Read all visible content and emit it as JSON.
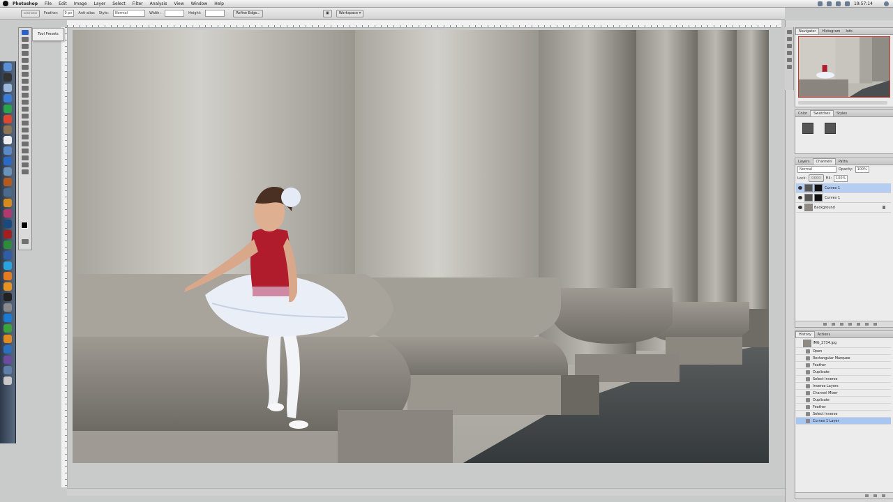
{
  "menubar": {
    "app_name": "Photoshop",
    "items": [
      "File",
      "Edit",
      "Image",
      "Layer",
      "Select",
      "Filter",
      "Analysis",
      "View",
      "Window",
      "Help"
    ],
    "clock": "19:57:14"
  },
  "optionsbar": {
    "feather_label": "Feather:",
    "feather_value": "0 px",
    "antialias_label": "Anti-alias",
    "style_label": "Style:",
    "style_value": "Normal",
    "width_label": "Width:",
    "height_label": "Height:",
    "refine_button": "Refine Edge...",
    "workspace": "Workspace ▾"
  },
  "tooltip": {
    "text": "Tool Presets"
  },
  "panels": {
    "navigator": {
      "tabs": [
        "Navigator",
        "Histogram",
        "Info"
      ]
    },
    "swatches": {
      "tabs": [
        "Color",
        "Swatches",
        "Styles"
      ]
    },
    "layers": {
      "tabs": [
        "Layers",
        "Channels",
        "Paths"
      ],
      "blend_mode": "Normal",
      "opacity_label": "Opacity:",
      "opacity_value": "100%",
      "lock_label": "Lock:",
      "fill_label": "Fill:",
      "fill_value": "100%",
      "rows": [
        {
          "name": "Curves 1",
          "selected": true
        },
        {
          "name": "Curves 1",
          "selected": false
        },
        {
          "name": "Background",
          "selected": false
        }
      ]
    },
    "history": {
      "tabs": [
        "History",
        "Actions"
      ],
      "snapshot": "IMG_2734.jpg",
      "items": [
        {
          "label": "Open",
          "selected": false
        },
        {
          "label": "Rectangular Marquee",
          "selected": false
        },
        {
          "label": "Feather",
          "selected": false
        },
        {
          "label": "Duplicate",
          "selected": false
        },
        {
          "label": "Select Inverse",
          "selected": false
        },
        {
          "label": "Inverse Layers",
          "selected": false
        },
        {
          "label": "Channel Mixer",
          "selected": false
        },
        {
          "label": "Duplicate",
          "selected": false
        },
        {
          "label": "Feather",
          "selected": false
        },
        {
          "label": "Select Inverse",
          "selected": false
        },
        {
          "label": "Curves 1 Layer",
          "selected": true
        }
      ]
    }
  },
  "colors": {
    "accent_blue": "#2b62c7",
    "selection": "#b5cdf0",
    "leotard": "#b01c2c",
    "tutu": "#e9eef7"
  }
}
